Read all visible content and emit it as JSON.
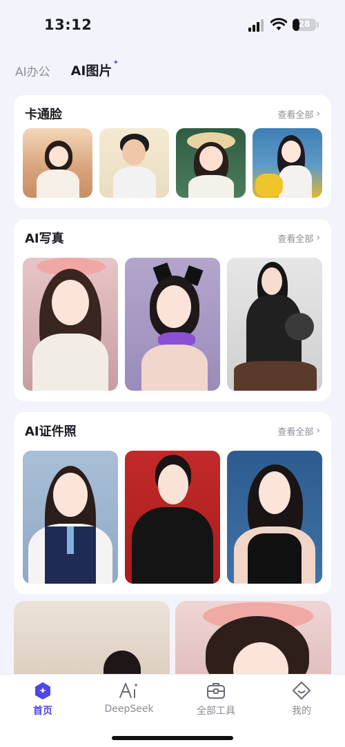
{
  "status_bar": {
    "time": "13:12",
    "battery": "28",
    "battery_level": 0.28
  },
  "top_tabs": [
    {
      "label": "AI办公",
      "active": false
    },
    {
      "label": "AI图片",
      "active": true
    }
  ],
  "sections": [
    {
      "title": "卡通脸",
      "view_all": "查看全部"
    },
    {
      "title": "AI写真",
      "view_all": "查看全部"
    },
    {
      "title": "AI证件照",
      "view_all": "查看全部"
    }
  ],
  "bottom_nav": [
    {
      "label": "首页",
      "icon": "home-icon",
      "active": true
    },
    {
      "label": "DeepSeek",
      "icon": "ai-sparkle-icon",
      "active": false
    },
    {
      "label": "全部工具",
      "icon": "toolbox-icon",
      "active": false
    },
    {
      "label": "我的",
      "icon": "profile-icon",
      "active": false
    }
  ],
  "colors": {
    "accent": "#4f46e5",
    "background": "#f3f3fb",
    "card": "#ffffff"
  }
}
